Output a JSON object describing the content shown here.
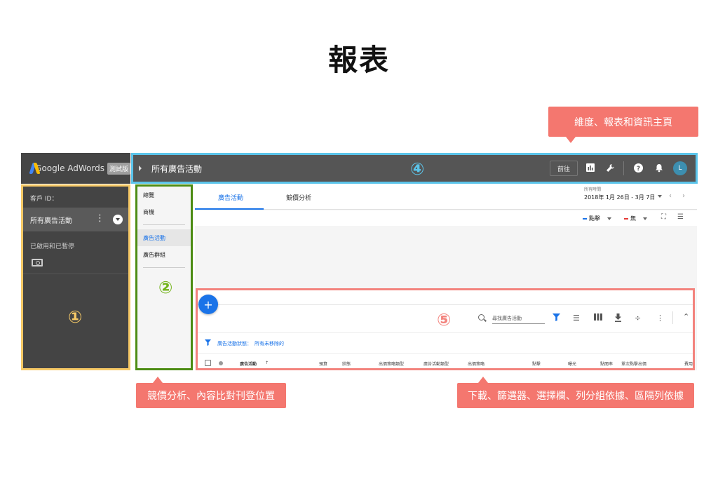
{
  "page": {
    "title": "報表"
  },
  "callouts": {
    "top_right": "維度、報表和資訊主頁",
    "bottom_left": "競價分析、內容比對刊登位置",
    "bottom_right": "下載、篩選器、選擇欄、列分組依據、區隔列依據"
  },
  "markers": {
    "one": "①",
    "two": "②",
    "four": "④",
    "five": "⑤"
  },
  "app": {
    "logo_text": "Google AdWords",
    "beta_label": "測試版",
    "header": {
      "title": "所有廣告活動",
      "goto_label": "前往",
      "avatar_initial": "L",
      "icons": [
        "reports-icon",
        "wrench-icon",
        "help-icon",
        "bell-icon"
      ]
    },
    "left_panel": {
      "customer_id_label": "客戶 ID：",
      "selected_item": "所有廣告活動",
      "status_filter": "已啟用和已暫停"
    },
    "nav": {
      "items": [
        {
          "label": "總覽",
          "active": false
        },
        {
          "label": "商機",
          "active": false
        },
        {
          "label": "廣告活動",
          "active": true
        },
        {
          "label": "廣告群組",
          "active": false
        }
      ]
    },
    "tabs": [
      {
        "label": "廣告活動",
        "active": true
      },
      {
        "label": "競價分析",
        "active": false
      }
    ],
    "date": {
      "label": "所有時間",
      "range": "2018年 1月 26日 - 3月 7日"
    },
    "chart_metrics": [
      {
        "label": "點擊",
        "color": "#1a73e8"
      },
      {
        "label": "無",
        "color": "#e53935"
      }
    ],
    "table": {
      "add_label": "+",
      "search_placeholder": "尋找廣告活動",
      "filter_label": "廣告活動狀態：",
      "filter_value": "所有未移除的",
      "columns": [
        "廣告活動",
        "預算",
        "狀態",
        "出價策略類型",
        "廣告活動類型",
        "出價策略",
        "點擊",
        "曝光",
        "點閱率",
        "單次點擊出價",
        "費用"
      ],
      "sort_indicator": "↑"
    }
  }
}
